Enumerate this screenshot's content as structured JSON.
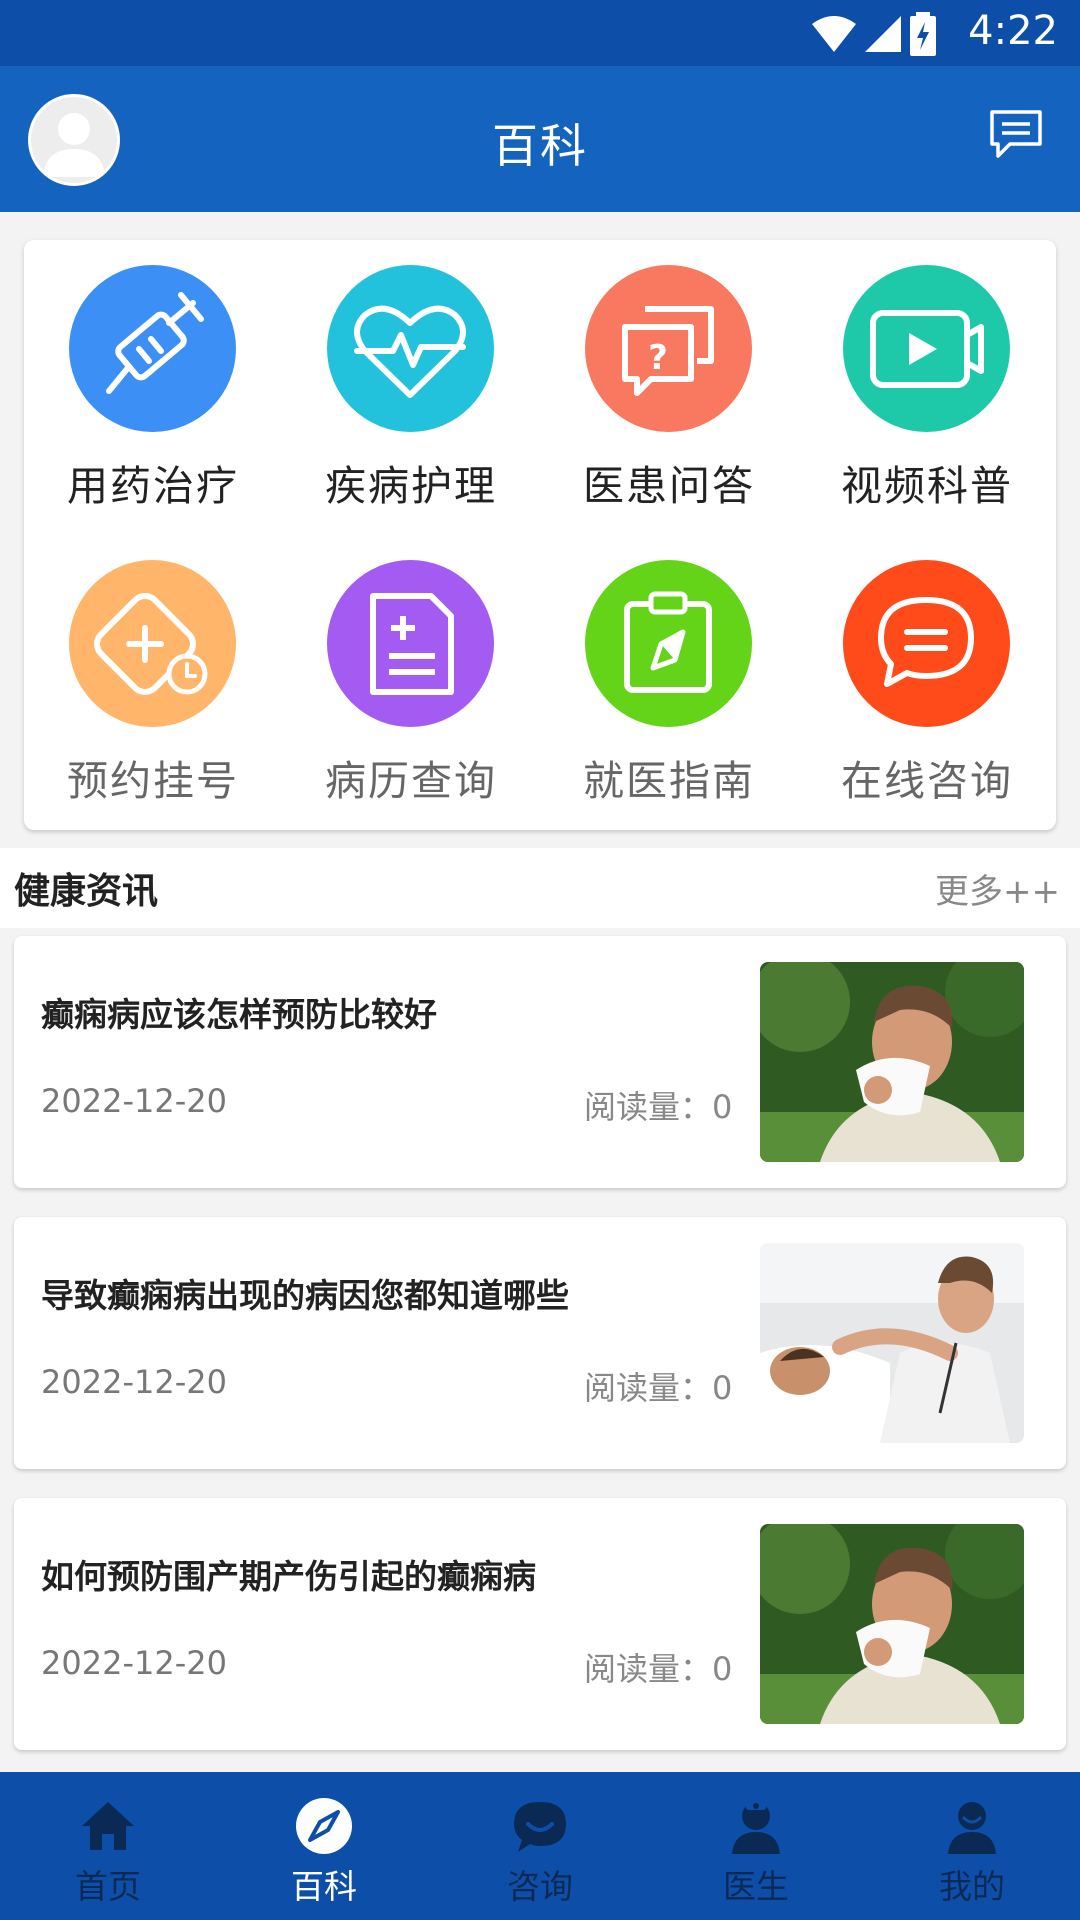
{
  "status_bar": {
    "time": "4:22"
  },
  "header": {
    "title": "百科",
    "avatar_icon": "avatar-placeholder",
    "message_icon": "message-icon"
  },
  "menu": {
    "items": [
      {
        "label": "用药治疗",
        "icon": "syringe-icon",
        "color": "#3b8ff5"
      },
      {
        "label": "疾病护理",
        "icon": "heartbeat-icon",
        "color": "#22c2dd"
      },
      {
        "label": "医患问答",
        "icon": "question-chat-icon",
        "color": "#f8795f"
      },
      {
        "label": "视频科普",
        "icon": "video-icon",
        "color": "#1ec9a9"
      },
      {
        "label": "预约挂号",
        "icon": "appointment-icon",
        "color": "#ffb56a"
      },
      {
        "label": "病历查询",
        "icon": "medical-record-icon",
        "color": "#a35bf2"
      },
      {
        "label": "就医指南",
        "icon": "clipboard-compass-icon",
        "color": "#63d418"
      },
      {
        "label": "在线咨询",
        "icon": "chat-icon",
        "color": "#ff4a1a"
      }
    ]
  },
  "news": {
    "title": "健康资讯",
    "more": "更多++",
    "articles": [
      {
        "title": "癫痫病应该怎样预防比较好",
        "date": "2022-12-20",
        "reads": "阅读量：0"
      },
      {
        "title": "导致癫痫病出现的病因您都知道哪些",
        "date": "2022-12-20",
        "reads": "阅读量：0"
      },
      {
        "title": "如何预防围产期产伤引起的癫痫病",
        "date": "2022-12-20",
        "reads": "阅读量：0"
      }
    ]
  },
  "bottom_nav": {
    "items": [
      {
        "label": "首页",
        "icon": "home-icon",
        "active": false
      },
      {
        "label": "百科",
        "icon": "compass-icon",
        "active": true
      },
      {
        "label": "咨询",
        "icon": "chat-bubble-icon",
        "active": false
      },
      {
        "label": "医生",
        "icon": "doctor-icon",
        "active": false
      },
      {
        "label": "我的",
        "icon": "user-icon",
        "active": false
      }
    ]
  }
}
